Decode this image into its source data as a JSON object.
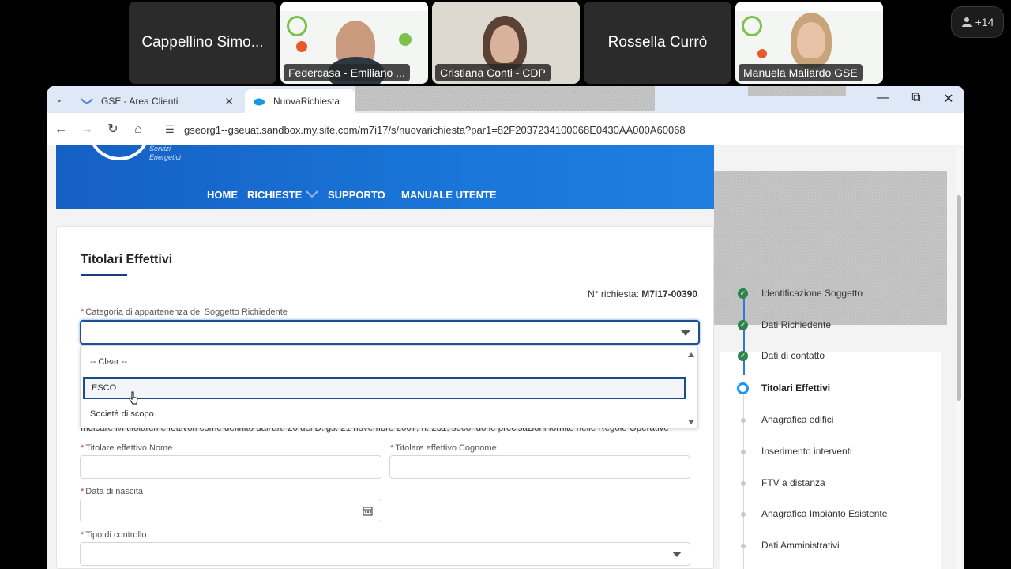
{
  "participants": [
    {
      "name": "Cappellino Simo...",
      "video": false
    },
    {
      "name": "Federcasa - Emiliano ...",
      "video": true
    },
    {
      "name": "Cristiana Conti - CDP",
      "video": true
    },
    {
      "name": "Rossella Currò",
      "video": false
    },
    {
      "name": "Manuela Maliardo GSE",
      "video": true
    }
  ],
  "more_participants": "+14",
  "browser": {
    "tabs": [
      {
        "title": "GSE - Area Clienti",
        "active": false
      },
      {
        "title": "NuovaRichiesta",
        "active": true
      }
    ],
    "url": "gseorg1--gseuat.sandbox.my.site.com/m7i17/s/nuovarichiesta?par1=82F2037234100068E0430AA000A60068"
  },
  "site": {
    "brand_line1": "Servizi",
    "brand_line2": "Energetici",
    "menu": [
      "HOME",
      "RICHIESTE",
      "SUPPORTO",
      "MANUALE UTENTE"
    ]
  },
  "form": {
    "title": "Titolari Effettivi",
    "request_label": "N° richiesta:",
    "request_number": "M7I17-00390",
    "category_label": "Categoria di appartenenza del Soggetto Richiedente",
    "category_value": "",
    "dropdown_options": [
      "-- Clear --",
      "ESCO",
      "Società di scopo"
    ],
    "dropdown_highlighted": "ESCO",
    "helper_text": "Indicare il/i titolare/i effettivo/i come definito dall'art. 20 del D.lgs. 21 novembre 2007, n. 231, secondo le precisazioni fornite nelle Regole Operative",
    "nome_label": "Titolare effettivo Nome",
    "cognome_label": "Titolare effettivo Cognome",
    "nascita_label": "Data di nascita",
    "controllo_label": "Tipo di controllo"
  },
  "steps": [
    {
      "label": "Identificazione Soggetto",
      "status": "done"
    },
    {
      "label": "Dati Richiedente",
      "status": "done"
    },
    {
      "label": "Dati di contatto",
      "status": "done"
    },
    {
      "label": "Titolari Effettivi",
      "status": "current"
    },
    {
      "label": "Anagrafica edifici",
      "status": "pending"
    },
    {
      "label": "Inserimento interventi",
      "status": "pending"
    },
    {
      "label": "FTV a distanza",
      "status": "pending"
    },
    {
      "label": "Anagrafica Impianto Esistente",
      "status": "pending"
    },
    {
      "label": "Dati Amministrativi",
      "status": "pending"
    }
  ],
  "colors": {
    "banner": "#1a6fd4",
    "accent": "#1b5297",
    "done": "#2e844a",
    "current": "#1b96ff"
  }
}
